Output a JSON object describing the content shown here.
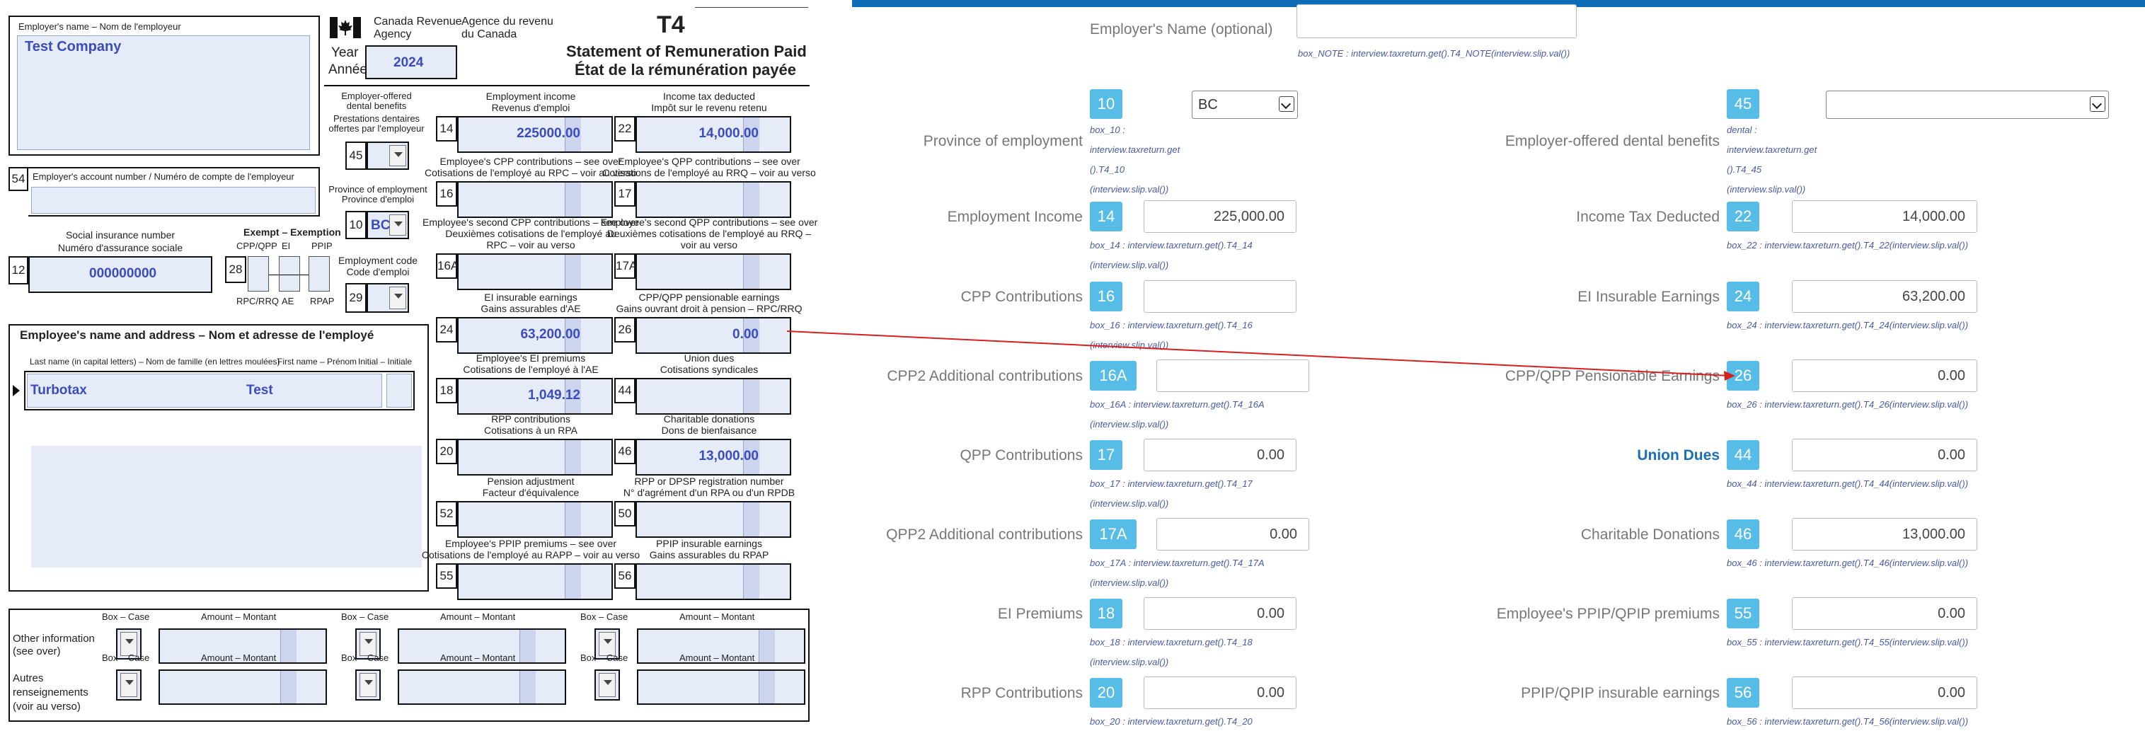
{
  "form": {
    "employer_name_label": "Employer's name – Nom de l'employeur",
    "employer_name": "Test Company",
    "agency_en": "Canada Revenue",
    "agency_en2": "Agency",
    "agency_fr": "Agence du revenu",
    "agency_fr2": "du Canada",
    "form_code": "T4",
    "year_label": "Year",
    "year_label_fr": "Année",
    "year": "2024",
    "title_en": "Statement of Remuneration Paid",
    "title_fr": "État de la rémunération payée",
    "dental_label": [
      "Employer-offered",
      "dental benefits",
      "Prestations dentaires",
      "offertes par l'employeur"
    ],
    "box54_label": "Employer's account number / Numéro de compte de l'employeur",
    "province_label": [
      "Province of employment",
      "Province d'emploi"
    ],
    "province_value": "BC",
    "sin_label": [
      "Social insurance number",
      "Numéro d'assurance sociale"
    ],
    "sin": "000000000",
    "exempt_label": "Exempt – Exemption",
    "exempt_cols": [
      "CPP/QPP",
      "EI",
      "PPIP"
    ],
    "exempt_cols_fr": [
      "RPC/RRQ",
      "AE",
      "RPAP"
    ],
    "employment_code_label": [
      "Employment code",
      "Code d'emploi"
    ],
    "employee_section_title": "Employee's name and address – Nom et adresse de l'employé",
    "last_name_label": "Last name (in capital letters) – Nom de famille (en lettres moulées)",
    "first_name_label": "First name – Prénom",
    "initial_label": "Initial – Initiale",
    "last_name": "Turbotax",
    "first_name": "Test",
    "boxes": {
      "b14": {
        "l1": "Employment income",
        "l2": "Revenus d'emploi",
        "value": "225000.00"
      },
      "b22": {
        "l1": "Income tax deducted",
        "l2": "Impôt sur le revenu retenu",
        "value": "14,000.00"
      },
      "b16": {
        "l1": "Employee's CPP contributions – see over",
        "l2": "Cotisations de l'employé au RPC – voir au verso",
        "value": ""
      },
      "b17": {
        "l1": "Employee's QPP contributions – see over",
        "l2": "Cotisations de l'employé au RRQ – voir au verso",
        "value": ""
      },
      "b16a": {
        "l1": "Employee's second CPP contributions – see over",
        "l2": "Deuxièmes cotisations de l'employé au",
        "l3": "RPC – voir au verso",
        "value": ""
      },
      "b17a": {
        "l1": "Employee's second QPP contributions – see over",
        "l2": "Deuxièmes cotisations de l'employé au RRQ –",
        "l3": "voir au verso",
        "value": ""
      },
      "b24": {
        "l1": "EI insurable earnings",
        "l2": "Gains assurables d'AE",
        "value": "63,200.00"
      },
      "b26": {
        "l1": "CPP/QPP pensionable earnings",
        "l2": "Gains ouvrant droit à pension – RPC/RRQ",
        "value": "0.00"
      },
      "b18": {
        "l1": "Employee's EI premiums",
        "l2": "Cotisations de l'employé à l'AE",
        "value": "1,049.12"
      },
      "b44": {
        "l1": "Union dues",
        "l2": "Cotisations syndicales",
        "value": ""
      },
      "b20": {
        "l1": "RPP contributions",
        "l2": "Cotisations à un RPA",
        "value": ""
      },
      "b46": {
        "l1": "Charitable donations",
        "l2": "Dons de bienfaisance",
        "value": "13,000.00"
      },
      "b52": {
        "l1": "Pension adjustment",
        "l2": "Facteur d'équivalence",
        "value": ""
      },
      "b50": {
        "l1": "RPP or DPSP registration number",
        "l2": "N° d'agrément d'un RPA ou d'un RPDB",
        "value": ""
      },
      "b55": {
        "l1": "Employee's PPIP premiums – see over",
        "l2": "Cotisations de l'employé au RAPP – voir au verso",
        "value": ""
      },
      "b56": {
        "l1": "PPIP insurable earnings",
        "l2": "Gains assurables du RPAP",
        "value": ""
      }
    },
    "other_info_label": [
      "Other information",
      "(see over)",
      "Autres",
      "renseignements",
      "(voir au verso)"
    ],
    "box_case_label": "Box – Case",
    "amount_label": "Amount – Montant"
  },
  "interview": {
    "employer_name_label": "Employer's Name (optional)",
    "box_note": "box_NOTE : interview.taxreturn.get().T4_NOTE(interview.slip.val())",
    "rows": [
      {
        "label": "Province of employment",
        "box": "10",
        "value": "BC",
        "kind": "select",
        "note": [
          "box_10 :",
          "interview.taxreturn.get",
          "().T4_10",
          "(interview.slip.val())"
        ],
        "r_label": "Employer-offered dental benefits",
        "r_box": "45",
        "r_value": "",
        "r_kind": "select",
        "r_note": [
          "dental :",
          "interview.taxreturn.get",
          "().T4_45",
          "(interview.slip.val())"
        ]
      },
      {
        "label": "Employment Income",
        "box": "14",
        "value": "225,000.00",
        "note": [
          "box_14 : interview.taxreturn.get().T4_14",
          "(interview.slip.val())"
        ],
        "r_label": "Income Tax Deducted",
        "r_box": "22",
        "r_value": "14,000.00",
        "r_note": [
          "box_22 : interview.taxreturn.get().T4_22(interview.slip.val())"
        ]
      },
      {
        "label": "CPP Contributions",
        "box": "16",
        "value": "",
        "note": [
          "box_16 : interview.taxreturn.get().T4_16",
          "(interview.slip.val())"
        ],
        "r_label": "EI Insurable Earnings",
        "r_box": "24",
        "r_value": "63,200.00",
        "r_note": [
          "box_24 : interview.taxreturn.get().T4_24(interview.slip.val())"
        ]
      },
      {
        "label": "CPP2 Additional contributions",
        "box": "16A",
        "value": "",
        "note": [
          "box_16A : interview.taxreturn.get().T4_16A",
          "(interview.slip.val())"
        ],
        "r_label": "CPP/QPP Pensionable Earnings",
        "r_box": "26",
        "r_value": "0.00",
        "r_note": [
          "box_26 : interview.taxreturn.get().T4_26(interview.slip.val())"
        ]
      },
      {
        "label": "QPP Contributions",
        "box": "17",
        "value": "0.00",
        "note": [
          "box_17 : interview.taxreturn.get().T4_17",
          "(interview.slip.val())"
        ],
        "r_label": "Union Dues",
        "r_box": "44",
        "r_value": "0.00",
        "r_note": [
          "box_44 : interview.taxreturn.get().T4_44(interview.slip.val())"
        ],
        "r_highlight": true
      },
      {
        "label": "QPP2 Additional contributions",
        "box": "17A",
        "value": "0.00",
        "note": [
          "box_17A : interview.taxreturn.get().T4_17A",
          "(interview.slip.val())"
        ],
        "r_label": "Charitable Donations",
        "r_box": "46",
        "r_value": "13,000.00",
        "r_note": [
          "box_46 : interview.taxreturn.get().T4_46(interview.slip.val())"
        ]
      },
      {
        "label": "EI Premiums",
        "box": "18",
        "value": "0.00",
        "note": [
          "box_18 : interview.taxreturn.get().T4_18",
          "(interview.slip.val())"
        ],
        "r_label": "Employee's PPIP/QPIP premiums",
        "r_box": "55",
        "r_value": "0.00",
        "r_note": [
          "box_55 : interview.taxreturn.get().T4_55(interview.slip.val())"
        ]
      },
      {
        "label": "RPP Contributions",
        "box": "20",
        "value": "0.00",
        "note": [
          "box_20 : interview.taxreturn.get().T4_20"
        ],
        "r_label": "PPIP/QPIP insurable earnings",
        "r_box": "56",
        "r_value": "0.00",
        "r_note": [
          "box_56 : interview.taxreturn.get().T4_56(interview.slip.val())"
        ]
      }
    ]
  },
  "colors": {
    "accent": "#57bde6",
    "top_bar": "#0d6cb5",
    "form_value": "#3b4dbd",
    "arrow": "#d62020",
    "link_label": "#1a6fb5"
  }
}
